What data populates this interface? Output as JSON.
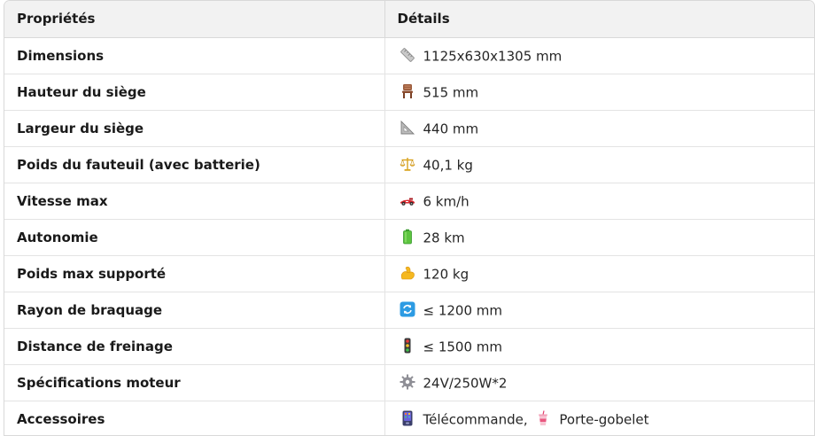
{
  "table": {
    "headers": [
      "Propriétés",
      "Détails"
    ],
    "rows": [
      {
        "property": "Dimensions",
        "icon": "ruler-icon",
        "value": "1125x630x1305 mm"
      },
      {
        "property": "Hauteur du siège",
        "icon": "chair-icon",
        "value": "515 mm"
      },
      {
        "property": "Largeur du siège",
        "icon": "triangular-ruler-icon",
        "value": "440 mm"
      },
      {
        "property": "Poids du fauteuil (avec batterie)",
        "icon": "balance-scale-icon",
        "value": "40,1 kg"
      },
      {
        "property": "Vitesse max",
        "icon": "race-car-icon",
        "value": "6 km/h"
      },
      {
        "property": "Autonomie",
        "icon": "battery-icon",
        "value": "28 km"
      },
      {
        "property": "Poids max supporté",
        "icon": "flexed-biceps-icon",
        "value": "120 kg"
      },
      {
        "property": "Rayon de braquage",
        "icon": "rotate-arrows-icon",
        "value": "≤ 1200 mm"
      },
      {
        "property": "Distance de freinage",
        "icon": "traffic-light-icon",
        "value": "≤ 1500 mm"
      },
      {
        "property": "Spécifications moteur",
        "icon": "gear-icon",
        "value": "24V/250W*2"
      },
      {
        "property": "Accessoires",
        "icon": "remote-control-icon",
        "value": "Télécommande,",
        "icon2": "cup-with-straw-icon",
        "value2": "Porte-gobelet"
      }
    ]
  },
  "colors": {
    "header_bg": "#f2f2f2",
    "border": "#d9d9d9"
  }
}
